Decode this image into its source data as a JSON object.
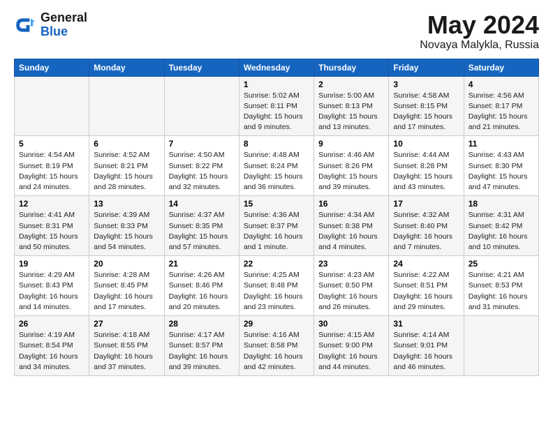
{
  "header": {
    "logo_general": "General",
    "logo_blue": "Blue",
    "month_title": "May 2024",
    "subtitle": "Novaya Malykla, Russia"
  },
  "days_of_week": [
    "Sunday",
    "Monday",
    "Tuesday",
    "Wednesday",
    "Thursday",
    "Friday",
    "Saturday"
  ],
  "weeks": [
    [
      {
        "day": "",
        "info": ""
      },
      {
        "day": "",
        "info": ""
      },
      {
        "day": "",
        "info": ""
      },
      {
        "day": "1",
        "info": "Sunrise: 5:02 AM\nSunset: 8:11 PM\nDaylight: 15 hours\nand 9 minutes."
      },
      {
        "day": "2",
        "info": "Sunrise: 5:00 AM\nSunset: 8:13 PM\nDaylight: 15 hours\nand 13 minutes."
      },
      {
        "day": "3",
        "info": "Sunrise: 4:58 AM\nSunset: 8:15 PM\nDaylight: 15 hours\nand 17 minutes."
      },
      {
        "day": "4",
        "info": "Sunrise: 4:56 AM\nSunset: 8:17 PM\nDaylight: 15 hours\nand 21 minutes."
      }
    ],
    [
      {
        "day": "5",
        "info": "Sunrise: 4:54 AM\nSunset: 8:19 PM\nDaylight: 15 hours\nand 24 minutes."
      },
      {
        "day": "6",
        "info": "Sunrise: 4:52 AM\nSunset: 8:21 PM\nDaylight: 15 hours\nand 28 minutes."
      },
      {
        "day": "7",
        "info": "Sunrise: 4:50 AM\nSunset: 8:22 PM\nDaylight: 15 hours\nand 32 minutes."
      },
      {
        "day": "8",
        "info": "Sunrise: 4:48 AM\nSunset: 8:24 PM\nDaylight: 15 hours\nand 36 minutes."
      },
      {
        "day": "9",
        "info": "Sunrise: 4:46 AM\nSunset: 8:26 PM\nDaylight: 15 hours\nand 39 minutes."
      },
      {
        "day": "10",
        "info": "Sunrise: 4:44 AM\nSunset: 8:28 PM\nDaylight: 15 hours\nand 43 minutes."
      },
      {
        "day": "11",
        "info": "Sunrise: 4:43 AM\nSunset: 8:30 PM\nDaylight: 15 hours\nand 47 minutes."
      }
    ],
    [
      {
        "day": "12",
        "info": "Sunrise: 4:41 AM\nSunset: 8:31 PM\nDaylight: 15 hours\nand 50 minutes."
      },
      {
        "day": "13",
        "info": "Sunrise: 4:39 AM\nSunset: 8:33 PM\nDaylight: 15 hours\nand 54 minutes."
      },
      {
        "day": "14",
        "info": "Sunrise: 4:37 AM\nSunset: 8:35 PM\nDaylight: 15 hours\nand 57 minutes."
      },
      {
        "day": "15",
        "info": "Sunrise: 4:36 AM\nSunset: 8:37 PM\nDaylight: 16 hours\nand 1 minute."
      },
      {
        "day": "16",
        "info": "Sunrise: 4:34 AM\nSunset: 8:38 PM\nDaylight: 16 hours\nand 4 minutes."
      },
      {
        "day": "17",
        "info": "Sunrise: 4:32 AM\nSunset: 8:40 PM\nDaylight: 16 hours\nand 7 minutes."
      },
      {
        "day": "18",
        "info": "Sunrise: 4:31 AM\nSunset: 8:42 PM\nDaylight: 16 hours\nand 10 minutes."
      }
    ],
    [
      {
        "day": "19",
        "info": "Sunrise: 4:29 AM\nSunset: 8:43 PM\nDaylight: 16 hours\nand 14 minutes."
      },
      {
        "day": "20",
        "info": "Sunrise: 4:28 AM\nSunset: 8:45 PM\nDaylight: 16 hours\nand 17 minutes."
      },
      {
        "day": "21",
        "info": "Sunrise: 4:26 AM\nSunset: 8:46 PM\nDaylight: 16 hours\nand 20 minutes."
      },
      {
        "day": "22",
        "info": "Sunrise: 4:25 AM\nSunset: 8:48 PM\nDaylight: 16 hours\nand 23 minutes."
      },
      {
        "day": "23",
        "info": "Sunrise: 4:23 AM\nSunset: 8:50 PM\nDaylight: 16 hours\nand 26 minutes."
      },
      {
        "day": "24",
        "info": "Sunrise: 4:22 AM\nSunset: 8:51 PM\nDaylight: 16 hours\nand 29 minutes."
      },
      {
        "day": "25",
        "info": "Sunrise: 4:21 AM\nSunset: 8:53 PM\nDaylight: 16 hours\nand 31 minutes."
      }
    ],
    [
      {
        "day": "26",
        "info": "Sunrise: 4:19 AM\nSunset: 8:54 PM\nDaylight: 16 hours\nand 34 minutes."
      },
      {
        "day": "27",
        "info": "Sunrise: 4:18 AM\nSunset: 8:55 PM\nDaylight: 16 hours\nand 37 minutes."
      },
      {
        "day": "28",
        "info": "Sunrise: 4:17 AM\nSunset: 8:57 PM\nDaylight: 16 hours\nand 39 minutes."
      },
      {
        "day": "29",
        "info": "Sunrise: 4:16 AM\nSunset: 8:58 PM\nDaylight: 16 hours\nand 42 minutes."
      },
      {
        "day": "30",
        "info": "Sunrise: 4:15 AM\nSunset: 9:00 PM\nDaylight: 16 hours\nand 44 minutes."
      },
      {
        "day": "31",
        "info": "Sunrise: 4:14 AM\nSunset: 9:01 PM\nDaylight: 16 hours\nand 46 minutes."
      },
      {
        "day": "",
        "info": ""
      }
    ]
  ]
}
